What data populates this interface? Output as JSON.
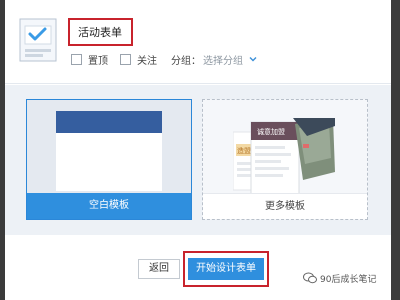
{
  "form": {
    "title": "活动表单",
    "options": {
      "pin_label": "置顶",
      "follow_label": "关注",
      "group_label": "分组：",
      "group_value": "选择分组"
    }
  },
  "templates": {
    "blank_label": "空白模板",
    "more_label": "更多模板",
    "preview_title": "诚意加盟",
    "preview_side_text": "造盟"
  },
  "footer": {
    "back_label": "返回",
    "start_label": "开始设计表单"
  },
  "watermark": {
    "text": "90后成长笔记"
  },
  "colors": {
    "accent_blue": "#2f8fde",
    "header_blue": "#355e9f",
    "highlight_red": "#c8232c"
  }
}
